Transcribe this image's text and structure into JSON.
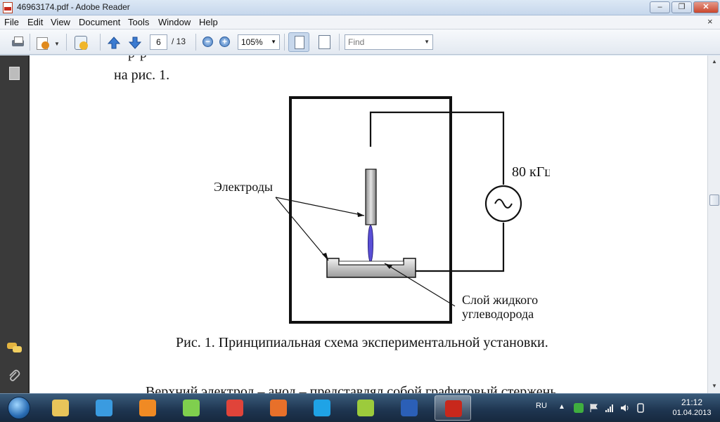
{
  "window": {
    "title": "46963174.pdf - Adobe Reader",
    "min_label": "–",
    "max_label": "❐",
    "close_label": "✕"
  },
  "menu": {
    "items": [
      "File",
      "Edit",
      "View",
      "Document",
      "Tools",
      "Window",
      "Help"
    ],
    "close_doc": "×"
  },
  "toolbar": {
    "page_current": "6",
    "page_total": "/ 13",
    "zoom_out_label": "−",
    "zoom_in_label": "+",
    "zoom": "105%",
    "find_placeholder": "Find"
  },
  "document": {
    "top_fragment": "р                                                        р",
    "line_na_ris": "на рис. 1.",
    "figure": {
      "label_electrodes": "Электроды",
      "label_frequency": "80 кГц",
      "label_layer_1": "Слой жидкого",
      "label_layer_2": "углеводорода"
    },
    "caption": "Рис. 1. Принципиальная схема экспериментальной установки.",
    "bottom_line": "Верхний электрод – анод – представлял собой графитовый стержень"
  },
  "taskbar": {
    "apps": [
      {
        "name": "explorer",
        "color": "#e8c45a",
        "active": false
      },
      {
        "name": "internet-explorer",
        "color": "#3a9be0",
        "active": false
      },
      {
        "name": "media-player",
        "color": "#f08a24",
        "active": false
      },
      {
        "name": "utility",
        "color": "#7fcf4e",
        "active": false
      },
      {
        "name": "chrome",
        "color": "#e0443a",
        "active": false
      },
      {
        "name": "firefox",
        "color": "#e8702a",
        "active": false
      },
      {
        "name": "skype",
        "color": "#1fa3e6",
        "active": false
      },
      {
        "name": "app-green-orange",
        "color": "#9ccb3c",
        "active": false
      },
      {
        "name": "word",
        "color": "#2b5fb7",
        "active": false
      },
      {
        "name": "adobe-reader",
        "color": "#c8281c",
        "active": true
      }
    ],
    "tray": {
      "language": "RU",
      "time": "21:12",
      "date": "01.04.2013"
    }
  }
}
